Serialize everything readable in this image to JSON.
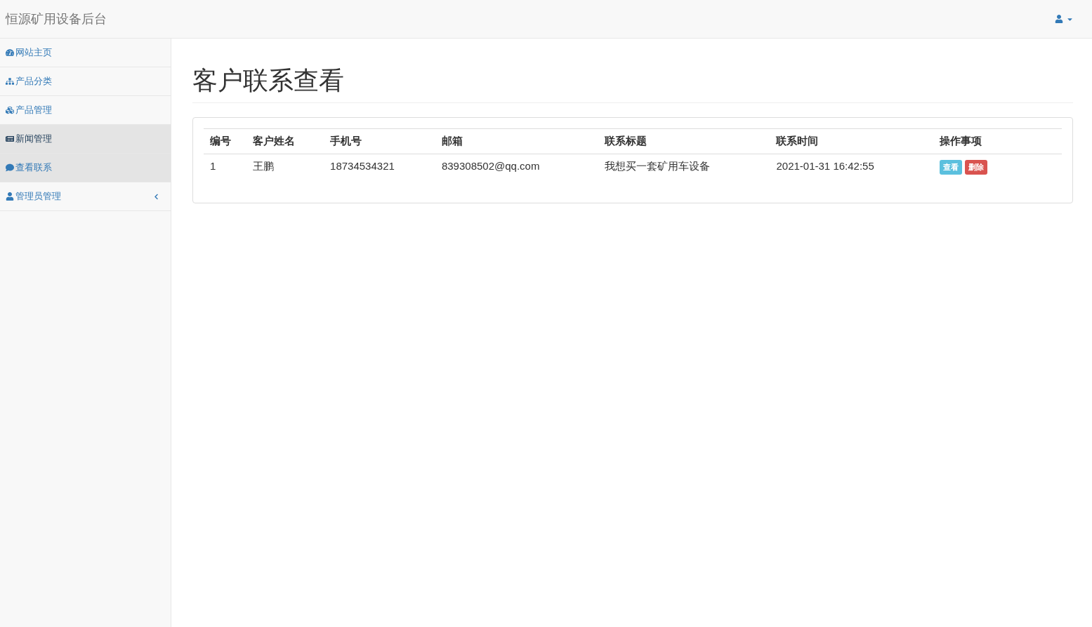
{
  "navbar": {
    "brand": "恒源矿用设备后台"
  },
  "sidebar": {
    "items": [
      {
        "label": "网站主页",
        "selected": false,
        "focused": false
      },
      {
        "label": "产品分类",
        "selected": false,
        "focused": false
      },
      {
        "label": "产品管理",
        "selected": false,
        "focused": false
      },
      {
        "label": "新闻管理",
        "selected": true,
        "focused": true
      },
      {
        "label": "查看联系",
        "selected": true,
        "focused": false
      },
      {
        "label": "管理员管理",
        "selected": false,
        "focused": false,
        "expanded": false
      }
    ]
  },
  "page": {
    "title": "客户联系查看"
  },
  "table": {
    "columns": [
      "编号",
      "客户姓名",
      "手机号",
      "邮箱",
      "联系标题",
      "联系时间",
      "操作事项"
    ],
    "rows": [
      {
        "cells": [
          "1",
          "王鹏",
          "18734534321",
          "839308502@qq.com",
          "我想买一套矿用车设备",
          "2021-01-31 16:42:55"
        ],
        "actions": [
          {
            "label": "查看",
            "kind": "view"
          },
          {
            "label": "删除",
            "kind": "delete"
          }
        ]
      }
    ]
  }
}
